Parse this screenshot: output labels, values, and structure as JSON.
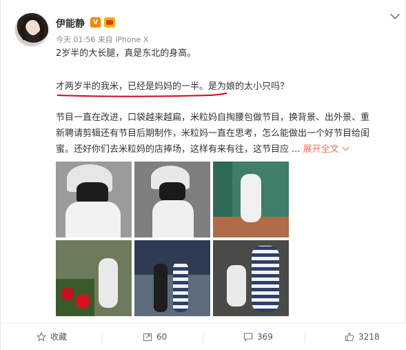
{
  "post": {
    "username": "伊能静",
    "vip_badge": "V",
    "meta": "今天 01:56 来自 iPhone X",
    "line1": "2岁半的大长腿，真是东北的身高。",
    "line2": "才两岁半的我米，已经是妈妈的一半。是为娘的太小只吗？",
    "line3": "节目一直在改进，口袋越来越扁，米粒妈自掏腰包做节目，换背景、出外景、重",
    "line4": "新聘请剪辑还有节目后期制作，米粒妈一直在思考，怎么能做出一个好节目给闺",
    "line5_prefix": "蜜。还好你们去米粒妈的店捧场，这样有来有往，这节目应 ... ",
    "expand_label": "展开全文",
    "underline_color": "#d0021b"
  },
  "photos": [
    {
      "icon": "photo-child-cap"
    },
    {
      "icon": "photo-child-cap-back"
    },
    {
      "icon": "photo-child-walking-green"
    },
    {
      "icon": "photo-child-with-flowers"
    },
    {
      "icon": "photo-family-walking-night"
    },
    {
      "icon": "photo-mother-child-sitting"
    }
  ],
  "actions": [
    {
      "label": "收藏",
      "icon": "star-icon"
    },
    {
      "label": "60",
      "icon": "repost-icon"
    },
    {
      "label": "369",
      "icon": "comment-icon"
    },
    {
      "label": "3218",
      "icon": "like-icon"
    }
  ],
  "colors": {
    "accent": "#eb7350",
    "vip": "#ff8200"
  }
}
